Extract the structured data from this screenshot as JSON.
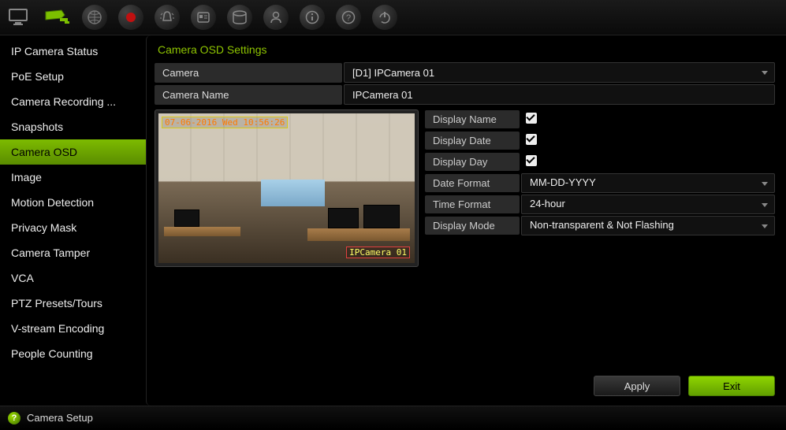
{
  "toolbar": {
    "icons": [
      "monitor",
      "camera",
      "globe",
      "record",
      "alarm",
      "badge",
      "disk",
      "user",
      "info",
      "help",
      "power"
    ]
  },
  "sidebar": {
    "items": [
      "IP Camera Status",
      "PoE Setup",
      "Camera Recording ...",
      "Snapshots",
      "Camera OSD",
      "Image",
      "Motion Detection",
      "Privacy Mask",
      "Camera Tamper",
      "VCA",
      "PTZ Presets/Tours",
      "V-stream Encoding",
      "People Counting"
    ],
    "active_index": 4
  },
  "panel": {
    "title": "Camera OSD Settings",
    "camera_label": "Camera",
    "camera_value": "[D1] IPCamera 01",
    "camera_name_label": "Camera Name",
    "camera_name_value": "IPCamera 01"
  },
  "preview": {
    "osd_time": "07-06-2016 Wed 10:56:26",
    "osd_name": "IPCamera 01"
  },
  "settings": {
    "display_name": {
      "label": "Display Name",
      "checked": true
    },
    "display_date": {
      "label": "Display Date",
      "checked": true
    },
    "display_day": {
      "label": "Display Day",
      "checked": true
    },
    "date_format": {
      "label": "Date Format",
      "value": "MM-DD-YYYY"
    },
    "time_format": {
      "label": "Time Format",
      "value": "24-hour"
    },
    "display_mode": {
      "label": "Display Mode",
      "value": "Non-transparent & Not Flashing"
    }
  },
  "buttons": {
    "apply": "Apply",
    "exit": "Exit"
  },
  "footer": {
    "title": "Camera Setup"
  },
  "colors": {
    "accent": "#8ec400"
  }
}
